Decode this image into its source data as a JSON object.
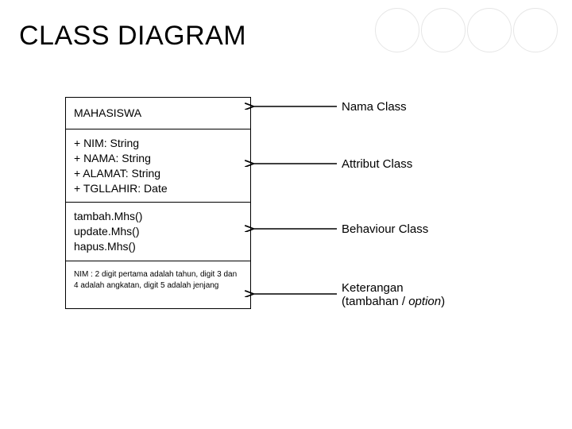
{
  "title": "CLASS DIAGRAM",
  "uml": {
    "className": "MAHASISWA",
    "attributes": [
      "+ NIM: String",
      "+ NAMA: String",
      "+ ALAMAT: String",
      "+ TGLLAHIR: Date"
    ],
    "behaviours": [
      "tambah.Mhs()",
      "update.Mhs()",
      "hapus.Mhs()"
    ],
    "note": "NIM : 2 digit pertama adalah tahun, digit 3 dan 4 adalah angkatan, digit 5 adalah jenjang"
  },
  "labels": {
    "name": "Nama Class",
    "attribute": "Attribut Class",
    "behaviour": "Behaviour Class",
    "note_line1": "Keterangan",
    "note_line2_a": "(tambahan / ",
    "note_line2_b": "option",
    "note_line2_c": ")"
  }
}
